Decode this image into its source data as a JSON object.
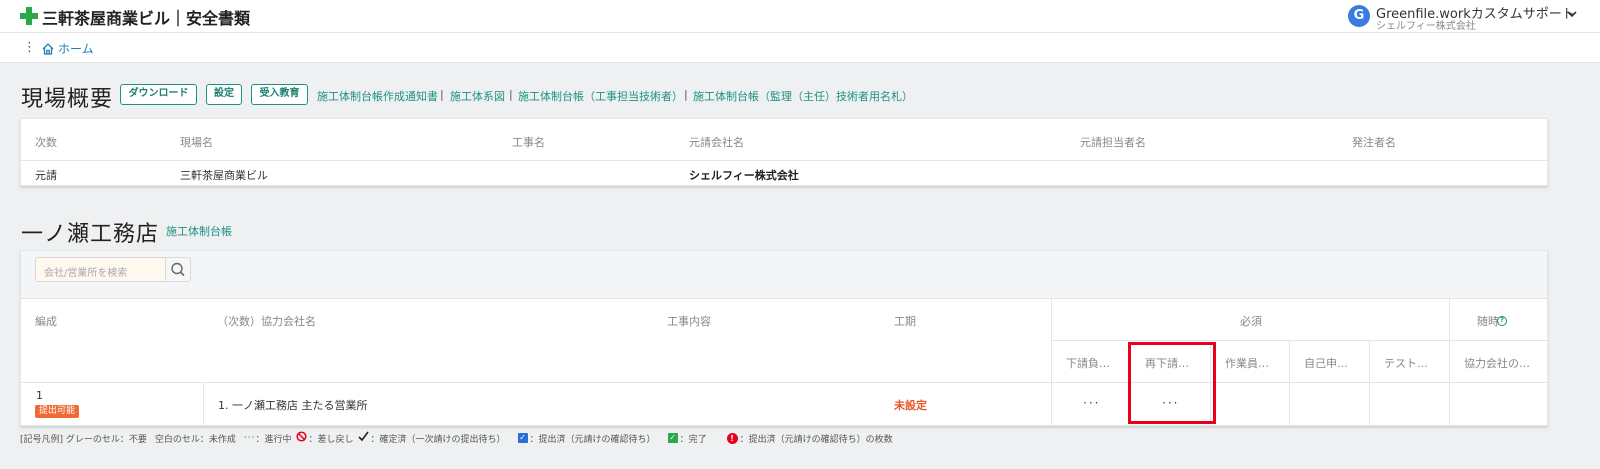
{
  "header": {
    "title": "三軒茶屋商業ビル｜安全書類",
    "user_initial": "G",
    "user_name": "Greenfile.workカスタムサポート",
    "user_company": "シェルフィー株式会社",
    "accent_color": "#2aa84a"
  },
  "breadcrumb": {
    "home": "ホーム"
  },
  "overview": {
    "title": "現場概要",
    "buttons": [
      "ダウンロード",
      "設定",
      "受入教育"
    ],
    "links": [
      "施工体制台帳作成通知書",
      "施工体系図",
      "施工体制台帳（工事担当技術者）",
      "施工体制台帳（監理（主任）技術者用名札）"
    ],
    "separator": "|",
    "table": {
      "headers": [
        "次数",
        "現場名",
        "工事名",
        "元請会社名",
        "元請担当者名",
        "発注者名"
      ],
      "row": [
        "元請",
        "三軒茶屋商業ビル",
        "",
        "シェルフィー株式会社",
        "",
        ""
      ]
    }
  },
  "company": {
    "title": "一ノ瀬工務店",
    "link": "施工体制台帳",
    "search_placeholder": "会社/営業所を検索",
    "table": {
      "headers": [
        "編成",
        "（次数）協力会社名",
        "工事内容",
        "工期"
      ],
      "group_required": "必須",
      "group_optional": "随時",
      "sub_headers": [
        "下請負…",
        "再下請…",
        "作業員…",
        "自己申…",
        "テスト…",
        "協力会社の…"
      ],
      "row": {
        "order": "1",
        "status_badge": "提出可能",
        "company_name": "1. 一ノ瀬工務店 主たる営業所",
        "work": "",
        "period": "未設定",
        "cell1": "···",
        "cell2": "···"
      }
    }
  },
  "legend": {
    "prefix": "[記号凡例] グレーのセル：不要",
    "empty": "空白のセル：未作成",
    "in_progress_symbol": "···",
    "in_progress": "：進行中",
    "rejected": "：差し戻し",
    "confirmed": "：確定済（一次請けの提出待ち）",
    "submitted": "：提出済（元請けの確認待ち）",
    "done": "：完了",
    "count_symbol": "!",
    "count": "：提出済（元請けの確認待ち）の枚数"
  }
}
